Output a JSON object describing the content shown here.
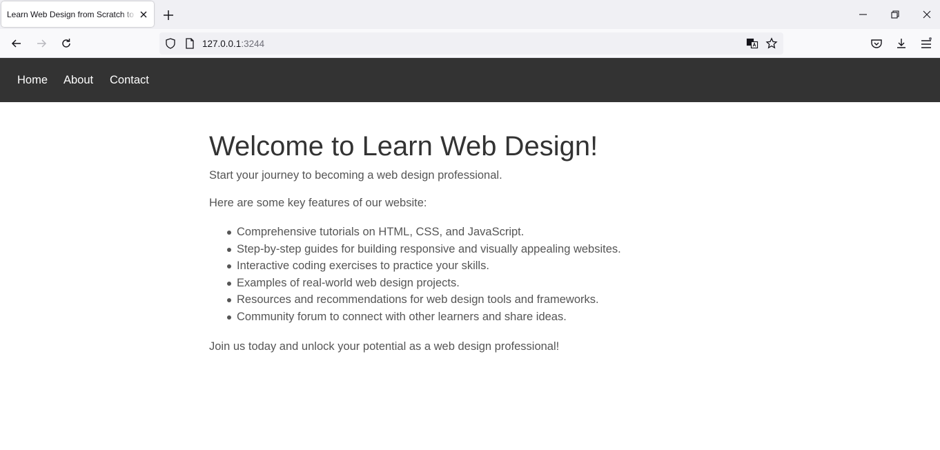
{
  "browser": {
    "tab_title": "Learn Web Design from Scratch to Pro",
    "url_host": "127.0.0.1",
    "url_port": ":3244"
  },
  "site": {
    "nav": [
      "Home",
      "About",
      "Contact"
    ],
    "heading": "Welcome to Learn Web Design!",
    "intro": "Start your journey to becoming a web design professional.",
    "features_intro": "Here are some key features of our website:",
    "features": [
      "Comprehensive tutorials on HTML, CSS, and JavaScript.",
      "Step-by-step guides for building responsive and visually appealing websites.",
      "Interactive coding exercises to practice your skills.",
      "Examples of real-world web design projects.",
      "Resources and recommendations for web design tools and frameworks.",
      "Community forum to connect with other learners and share ideas."
    ],
    "closing": "Join us today and unlock your potential as a web design professional!"
  },
  "colors": {
    "nav_background": "#333333",
    "heading": "#333333",
    "body_text": "#555555"
  }
}
